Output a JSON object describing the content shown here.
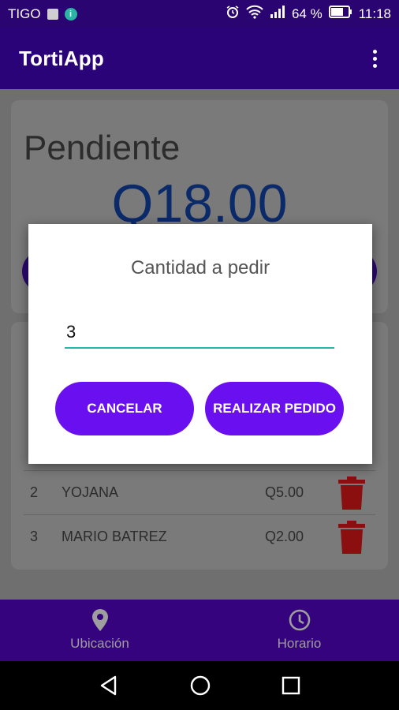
{
  "status_bar": {
    "carrier": "TIGO",
    "battery": "64 %",
    "time": "11:18"
  },
  "app_bar": {
    "title": "TortiApp"
  },
  "summary": {
    "label": "Pendiente",
    "amount": "Q18.00"
  },
  "orders": [
    {
      "num": "2",
      "name": "YOJANA",
      "amount": "Q5.00"
    },
    {
      "num": "3",
      "name": "MARIO BATREZ",
      "amount": "Q2.00"
    }
  ],
  "dialog": {
    "title": "Cantidad a pedir",
    "quantity_value": "3",
    "cancel_label": "CANCELAR",
    "submit_label": "REALIZAR PEDIDO"
  },
  "bottom_nav": {
    "location_label": "Ubicación",
    "schedule_label": "Horario"
  },
  "colors": {
    "primary": "#2b0378",
    "accent": "#6a0ff0",
    "input_underline": "#26b9a2",
    "trash": "#8b0f0f"
  }
}
